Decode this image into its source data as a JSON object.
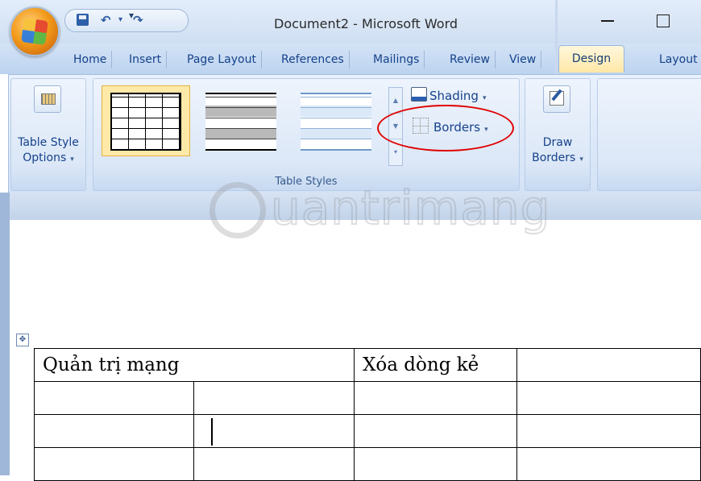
{
  "window": {
    "title": "Document2 - Microsoft Word"
  },
  "quick_access": {
    "more_arrow": "▾"
  },
  "tabs": [
    {
      "label": "Home"
    },
    {
      "label": "Insert"
    },
    {
      "label": "Page Layout"
    },
    {
      "label": "References"
    },
    {
      "label": "Mailings"
    },
    {
      "label": "Review"
    },
    {
      "label": "View"
    },
    {
      "label": "Design",
      "active": true
    },
    {
      "label": "Layout"
    }
  ],
  "ribbon": {
    "table_style_options": {
      "line1": "Table Style",
      "line2": "Options"
    },
    "table_styles": {
      "group_label": "Table Styles"
    },
    "shading": {
      "label": "Shading"
    },
    "borders": {
      "label": "Borders"
    },
    "draw_borders": {
      "line1": "Draw",
      "line2": "Borders"
    }
  },
  "watermark": {
    "text": "uantrimang"
  },
  "document": {
    "table": [
      [
        "Quản trị mạng",
        "",
        "Xóa dòng kẻ",
        ""
      ],
      [
        "",
        "",
        "",
        ""
      ],
      [
        "",
        "",
        "",
        ""
      ],
      [
        "",
        "",
        "",
        ""
      ]
    ],
    "merged_first_cell": true
  },
  "colors": {
    "ribbon_text": "#15428b",
    "highlight_circle": "#e00000",
    "active_tab": "#ffe7a6"
  }
}
